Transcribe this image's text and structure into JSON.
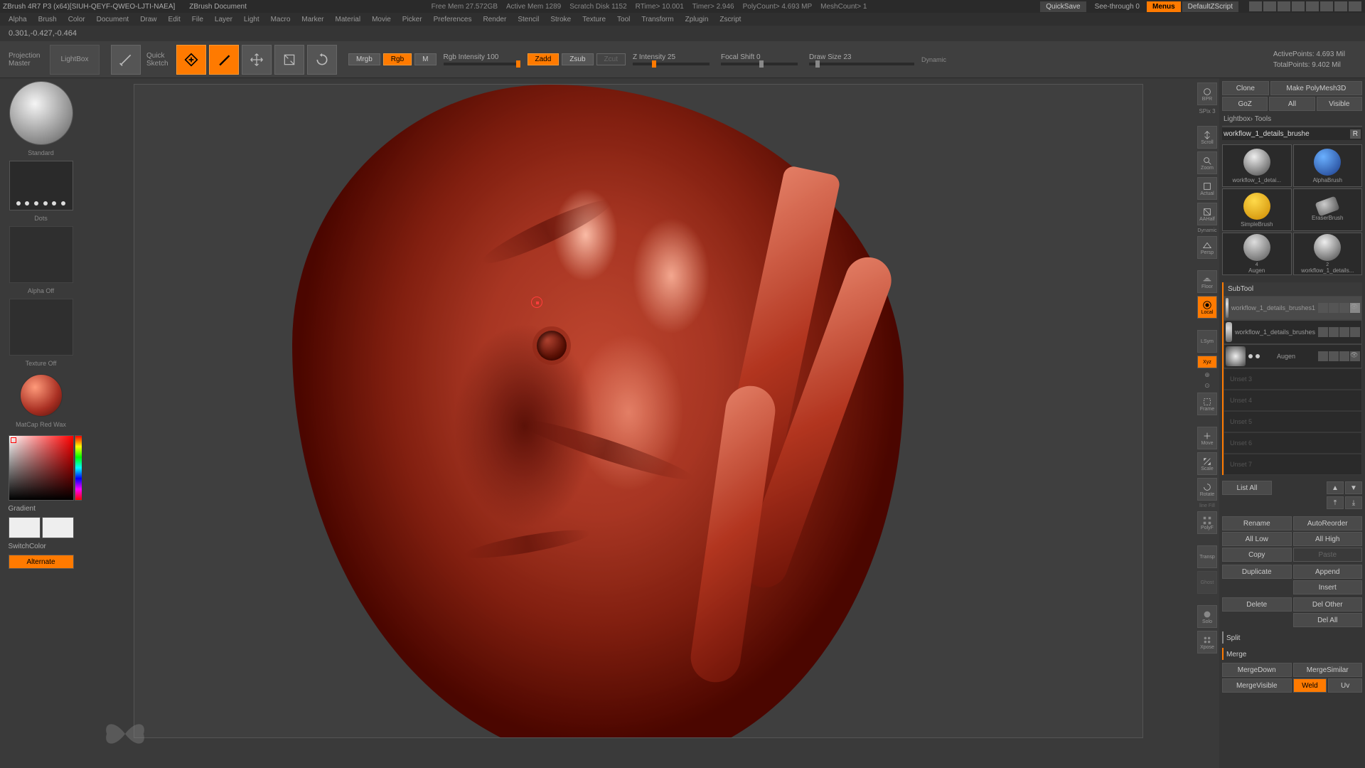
{
  "title_bar": {
    "app": "ZBrush 4R7 P3  (x64)[SIUH-QEYF-QWEO-LJTI-NAEA]",
    "doc": "ZBrush Document",
    "stats": {
      "free_mem": "Free Mem 27.572GB",
      "active_mem": "Active Mem 1289",
      "scratch": "Scratch Disk 1152",
      "rtime": "RTime> 10.001",
      "timer": "Timer> 2.946",
      "polycount": "PolyCount> 4.693 MP",
      "meshcount": "MeshCount> 1"
    },
    "quicksave": "QuickSave",
    "see_through": "See-through  0",
    "menus": "Menus",
    "default_script": "DefaultZScript"
  },
  "menus": [
    "Alpha",
    "Brush",
    "Color",
    "Document",
    "Draw",
    "Edit",
    "File",
    "Layer",
    "Light",
    "Macro",
    "Marker",
    "Material",
    "Movie",
    "Picker",
    "Preferences",
    "Render",
    "Stencil",
    "Stroke",
    "Texture",
    "Tool",
    "Transform",
    "Zplugin",
    "Zscript"
  ],
  "coords": "0.301,-0.427,-0.464",
  "toolbar": {
    "projection_master": {
      "line1": "Projection",
      "line2": "Master"
    },
    "lightbox": "LightBox",
    "quick_sketch": {
      "line1": "Quick",
      "line2": "Sketch"
    },
    "edit": "Edit",
    "draw": "Draw",
    "move": "Move",
    "scale": "Scale",
    "rotate": "Rotate",
    "mrgb": "Mrgb",
    "rgb": "Rgb",
    "m": "M",
    "rgb_intensity": "Rgb Intensity 100",
    "zadd": "Zadd",
    "zsub": "Zsub",
    "zcut": "Zcut",
    "z_intensity": "Z Intensity 25",
    "focal_shift": "Focal Shift 0",
    "draw_size": "Draw Size 23",
    "dynamic": "Dynamic",
    "active_points": "ActivePoints: 4.693 Mil",
    "total_points": "TotalPoints: 9.402 Mil"
  },
  "left": {
    "brush_thumb": "Standard",
    "stroke": "Dots",
    "alpha": "Alpha Off",
    "texture": "Texture Off",
    "material": "MatCap Red Wax",
    "gradient": "Gradient",
    "switch_color": "SwitchColor",
    "alternate": "Alternate"
  },
  "right_strip": {
    "bpr": "BPR",
    "spix": "SPix 3",
    "scroll": "Scroll",
    "zoom": "Zoom",
    "actual": "Actual",
    "aahalf": "AAHalf",
    "dynamic_m": "Dynamic",
    "persp": "Persp",
    "floor": "Floor",
    "local": "Local",
    "lsym": "LSym",
    "xyz": "Xyz",
    "frame": "Frame",
    "move": "Move",
    "scale": "Scale",
    "rotate": "Rotate",
    "polyf": "PolyF",
    "transp": "Transp",
    "ghost": "Ghost",
    "solo": "Solo",
    "xpose": "Xpose"
  },
  "right_panel": {
    "top": {
      "clone": "Clone",
      "make_poly": "Make PolyMesh3D",
      "goz": "GoZ",
      "all": "All",
      "visible": "Visible"
    },
    "lightbox_tools": "Lightbox› Tools",
    "tool_name": "workflow_1_details_brushe",
    "r": "R",
    "tools": {
      "a": "workflow_1_detai...",
      "b": "AlphaBrush",
      "c": "SimpleBrush",
      "d": "EraserBrush",
      "e": "Augen",
      "f": "workflow_1_details..."
    },
    "subtool": {
      "header": "SubTool",
      "items": [
        {
          "name": "workflow_1_details_brushes1"
        },
        {
          "name": "workflow_1_details_brushes"
        },
        {
          "name": "Augen"
        }
      ],
      "empties": [
        "Unset 3",
        "Unset 4",
        "Unset 5",
        "Unset 6",
        "Unset 7"
      ]
    },
    "list_all": "List All",
    "buttons": {
      "rename": "Rename",
      "autoreorder": "AutoReorder",
      "all_low": "All Low",
      "all_high": "All High",
      "copy": "Copy",
      "paste": "Paste",
      "duplicate": "Duplicate",
      "append": "Append",
      "insert": "Insert",
      "delete": "Delete",
      "del_other": "Del Other",
      "del_all": "Del All",
      "split": "Split",
      "merge": "Merge",
      "merge_down": "MergeDown",
      "merge_similar": "MergeSimilar",
      "merge_visible": "MergeVisible",
      "weld": "Weld",
      "uv": "Uv"
    }
  }
}
